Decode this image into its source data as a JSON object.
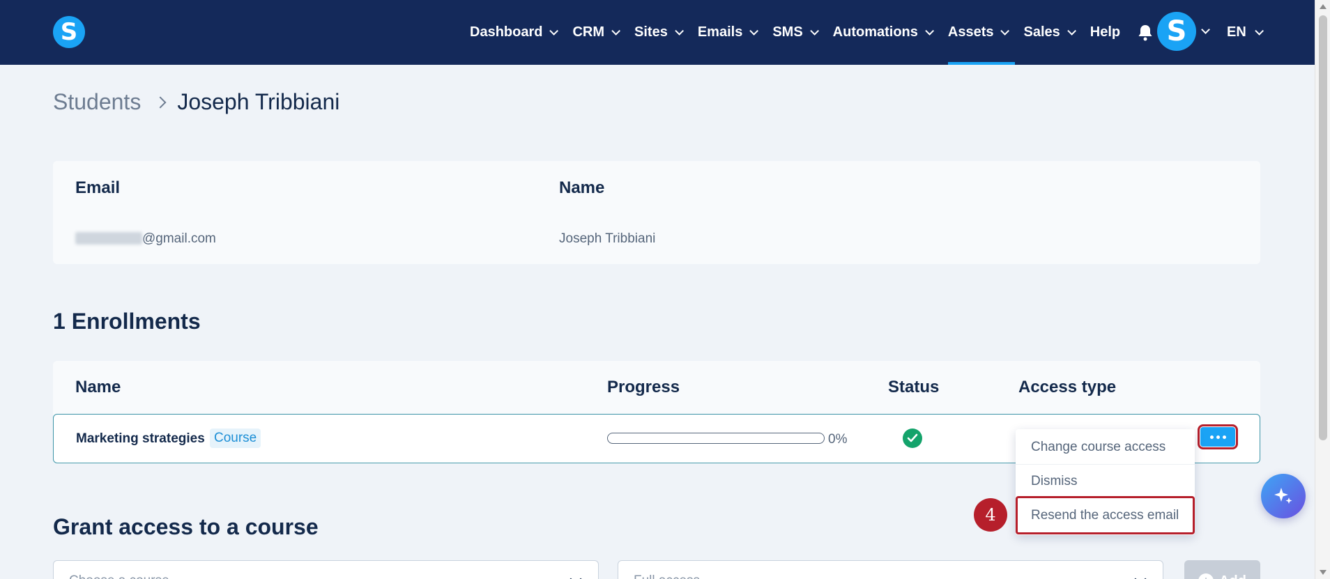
{
  "nav": {
    "logo_letter": "S",
    "items": [
      {
        "label": "Dashboard",
        "has_menu": true
      },
      {
        "label": "CRM",
        "has_menu": true
      },
      {
        "label": "Sites",
        "has_menu": true
      },
      {
        "label": "Emails",
        "has_menu": true
      },
      {
        "label": "SMS",
        "has_menu": true
      },
      {
        "label": "Automations",
        "has_menu": true
      },
      {
        "label": "Assets",
        "has_menu": true,
        "active": true
      },
      {
        "label": "Sales",
        "has_menu": true
      },
      {
        "label": "Help",
        "has_menu": false
      }
    ],
    "avatar_letter": "S",
    "language": "EN",
    "colors": {
      "bar": "#14295a",
      "accent": "#1aa3f5"
    }
  },
  "breadcrumb": {
    "parent": "Students",
    "current": "Joseph Tribbiani"
  },
  "student": {
    "email_label": "Email",
    "email_value": "@gmail.com",
    "name_label": "Name",
    "name_value": "Joseph Tribbiani"
  },
  "enrollments": {
    "title": "1 Enrollments",
    "headers": {
      "name": "Name",
      "progress": "Progress",
      "status": "Status",
      "access_type": "Access type"
    },
    "rows": [
      {
        "course": "Marketing strategies",
        "tag": "Course",
        "progress_percent": 0,
        "progress_label": "0%",
        "status": "check-circle-icon"
      }
    ]
  },
  "row_menu": {
    "items": [
      "Change course access",
      "Dismiss",
      "Resend the access email"
    ],
    "highlighted_index": 2,
    "step_number": "4"
  },
  "grant": {
    "title": "Grant access to a course",
    "course_placeholder": "Choose a course",
    "access_placeholder": "Full access",
    "add_label": "Add"
  }
}
